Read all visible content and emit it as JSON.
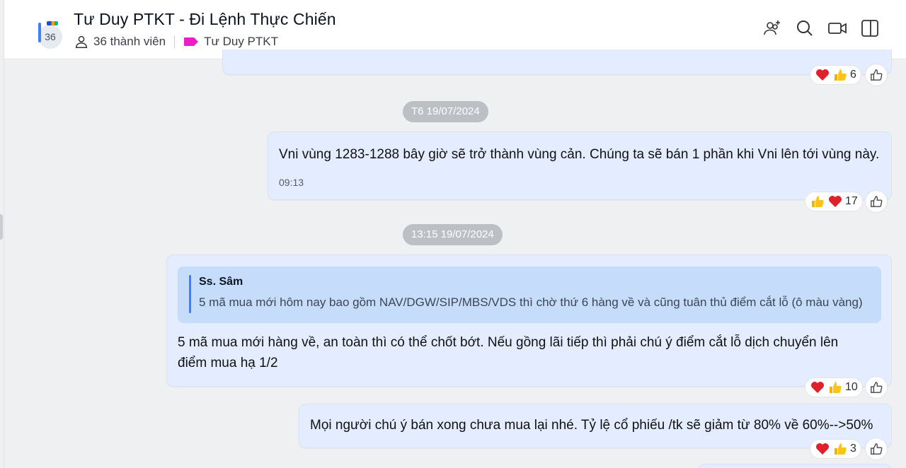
{
  "header": {
    "title": "Tư Duy PTKT - Đi Lệnh Thực Chiến",
    "avatar_count": "36",
    "members_text": "36 thành viên",
    "tag_label": "Tư Duy PTKT",
    "tag_color": "#e91ec8",
    "icons": [
      "add-member-icon",
      "search-icon",
      "video-call-icon",
      "sidebar-toggle-icon"
    ]
  },
  "messages": [
    {
      "type": "partial",
      "reactions": {
        "emojis": [
          "heart",
          "thumbs-up"
        ],
        "count": "6"
      }
    },
    {
      "date_pill": "T6 19/07/2024",
      "text": "Vni vùng 1283-1288 bây giờ sẽ trở thành vùng cản. Chúng ta sẽ bán 1 phần khi Vni lên tới vùng này.",
      "time": "09:13",
      "reactions": {
        "emojis": [
          "thumbs-up",
          "heart"
        ],
        "count": "17"
      }
    },
    {
      "date_pill": "13:15 19/07/2024",
      "quote": {
        "author": "Ss. Sâm",
        "text": "5 mã mua mới hôm nay bao gồm NAV/DGW/SIP/MBS/VDS thì chờ thứ 6 hàng về và cũng tuân thủ điểm cắt lỗ (ô màu vàng)"
      },
      "text_line1": "5 mã mua mới hàng về, an toàn thì có thể chốt bớt. Nếu gồng lãi tiếp thì phải chú ý điểm cắt lỗ dịch chuyển lên",
      "text_line2": "điểm mua hạ 1/2",
      "reactions": {
        "emojis": [
          "heart",
          "thumbs-up"
        ],
        "count": "10"
      }
    },
    {
      "text": "Mọi người chú ý bán xong chưa mua lại nhé. Tỷ lệ cổ phiếu /tk sẽ giảm từ 80% về 60%-->50%",
      "reactions": {
        "emojis": [
          "heart",
          "thumbs-up"
        ],
        "count": "3"
      }
    }
  ]
}
